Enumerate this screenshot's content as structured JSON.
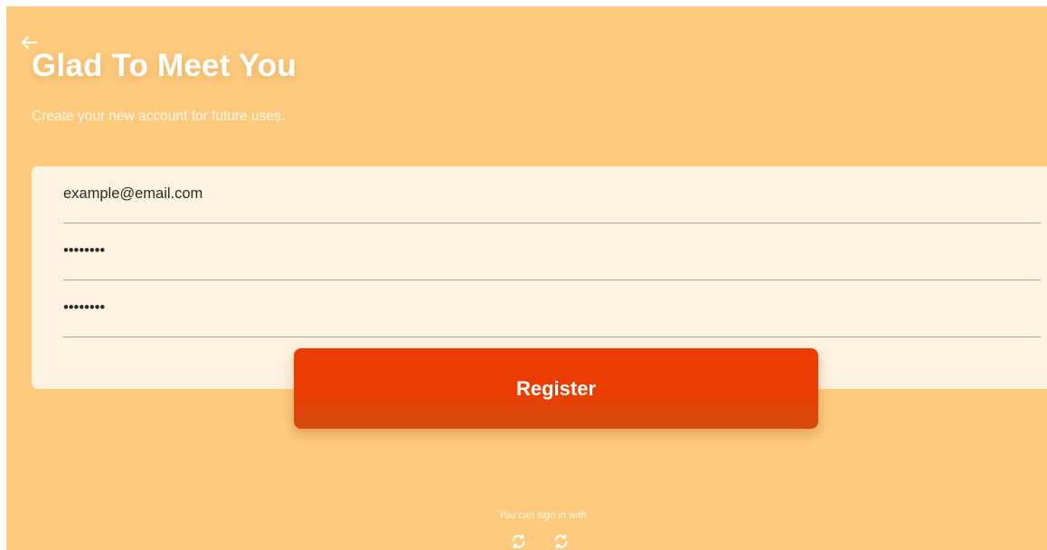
{
  "header": {
    "title": "Glad To Meet You",
    "subtitle": "Create your new account for future uses."
  },
  "form": {
    "email_value": "example@email.com",
    "password_value": "••••••••",
    "confirm_password_value": "••••••••",
    "register_label": "Register"
  },
  "footer": {
    "signin_hint": "You can sign in with",
    "social_icons": [
      "refresh-icon",
      "refresh-icon"
    ]
  },
  "colors": {
    "background": "#fecb7e",
    "card": "#fef3e0",
    "accent": "#ea3e02",
    "text_light": "#ffffff"
  },
  "icons": {
    "back": "arrow-left-icon"
  }
}
